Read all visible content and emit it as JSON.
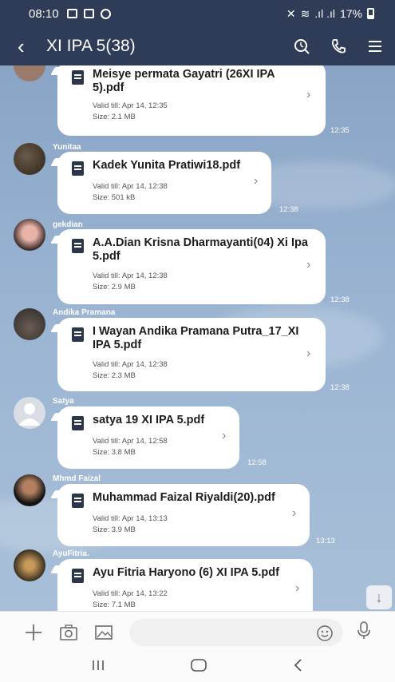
{
  "status_bar": {
    "time": "08:10",
    "battery": "17%"
  },
  "header": {
    "title": "XI IPA 5(38)"
  },
  "messages": [
    {
      "sender": "",
      "file": "Meisye permata Gayatri (26XI IPA 5).pdf",
      "valid": "Valid till: Apr 14, 12:35",
      "size": "Size: 2.1 MB",
      "time": "12:35"
    },
    {
      "sender": "Yunitaa",
      "file": "Kadek Yunita Pratiwi18.pdf",
      "valid": "Valid till: Apr 14, 12:38",
      "size": "Size: 501 kB",
      "time": "12:38"
    },
    {
      "sender": "gekdian",
      "file": "A.A.Dian Krisna Dharmayanti(04) Xi Ipa 5.pdf",
      "valid": "Valid till: Apr 14, 12:38",
      "size": "Size: 2.9 MB",
      "time": "12:38"
    },
    {
      "sender": "Andika Pramana",
      "file": "I Wayan Andika Pramana Putra_17_XI IPA 5.pdf",
      "valid": "Valid till: Apr 14, 12:38",
      "size": "Size: 2.3 MB",
      "time": "12:38"
    },
    {
      "sender": "Satya",
      "file": "satya 19 XI IPA 5.pdf",
      "valid": "Valid till: Apr 14, 12:58",
      "size": "Size: 3.8 MB",
      "time": "12:58"
    },
    {
      "sender": "Mhmd Faizal",
      "file": "Muhammad Faizal Riyaldi(20).pdf",
      "valid": "Valid till: Apr 14, 13:13",
      "size": "Size: 3.9 MB",
      "time": "13:13"
    },
    {
      "sender": "AyuFitria.",
      "file": "Ayu Fitria Haryono (6) XI IPA 5.pdf",
      "valid": "Valid till: Apr 14, 13:22",
      "size": "Size: 7.1 MB",
      "time": ""
    }
  ],
  "icons": {
    "header": [
      "back-icon",
      "search-icon",
      "phone-icon",
      "menu-icon"
    ],
    "input_bar": [
      "plus-icon",
      "camera-icon",
      "image-icon",
      "emoji-icon",
      "mic-icon"
    ],
    "nav_bar": [
      "recent-apps-icon",
      "home-icon",
      "back-nav-icon"
    ],
    "scroll": "arrow-down-icon"
  },
  "colors": {
    "header_bg": "#2f3c57",
    "chat_bg": "#8fa9c8",
    "bubble_bg": "#ffffff"
  }
}
